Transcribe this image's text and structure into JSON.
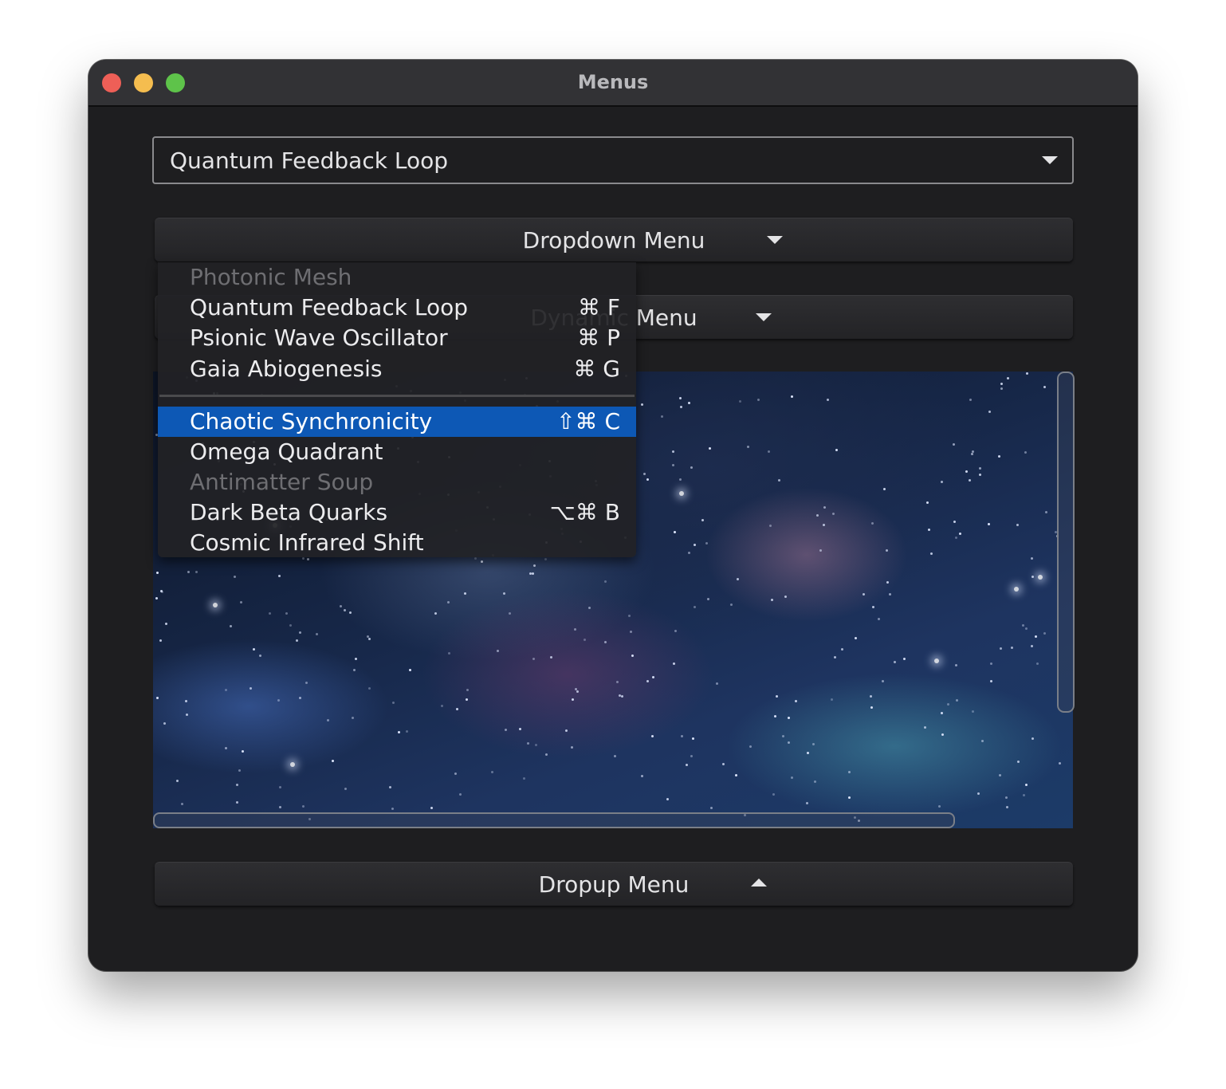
{
  "window": {
    "title": "Menus"
  },
  "combo": {
    "value": "Quantum Feedback Loop"
  },
  "buttons": {
    "dropdown": "Dropdown Menu",
    "dynamic": "Dynamic Menu",
    "dropup": "Dropup Menu"
  },
  "menu": {
    "items": [
      {
        "label": "Photonic Mesh",
        "shortcut": "",
        "disabled": true
      },
      {
        "label": "Quantum Feedback Loop",
        "shortcut": "⌘ F"
      },
      {
        "label": "Psionic Wave Oscillator",
        "shortcut": "⌘ P"
      },
      {
        "label": "Gaia Abiogenesis",
        "shortcut": "⌘ G"
      },
      {
        "label": "Chaotic Synchronicity",
        "shortcut": "⇧⌘ C",
        "selected": true
      },
      {
        "label": "Omega Quadrant",
        "shortcut": ""
      },
      {
        "label": "Antimatter Soup",
        "shortcut": "",
        "disabled": true
      },
      {
        "label": "Dark Beta Quarks",
        "shortcut": "⌥⌘ B"
      },
      {
        "label": "Cosmic Infrared Shift",
        "shortcut": ""
      }
    ]
  },
  "colors": {
    "selection": "#0d58b5",
    "window_bg": "#1e1e20",
    "titlebar": "#323235"
  },
  "image": {
    "description_icon": "nebula-starfield-image"
  }
}
